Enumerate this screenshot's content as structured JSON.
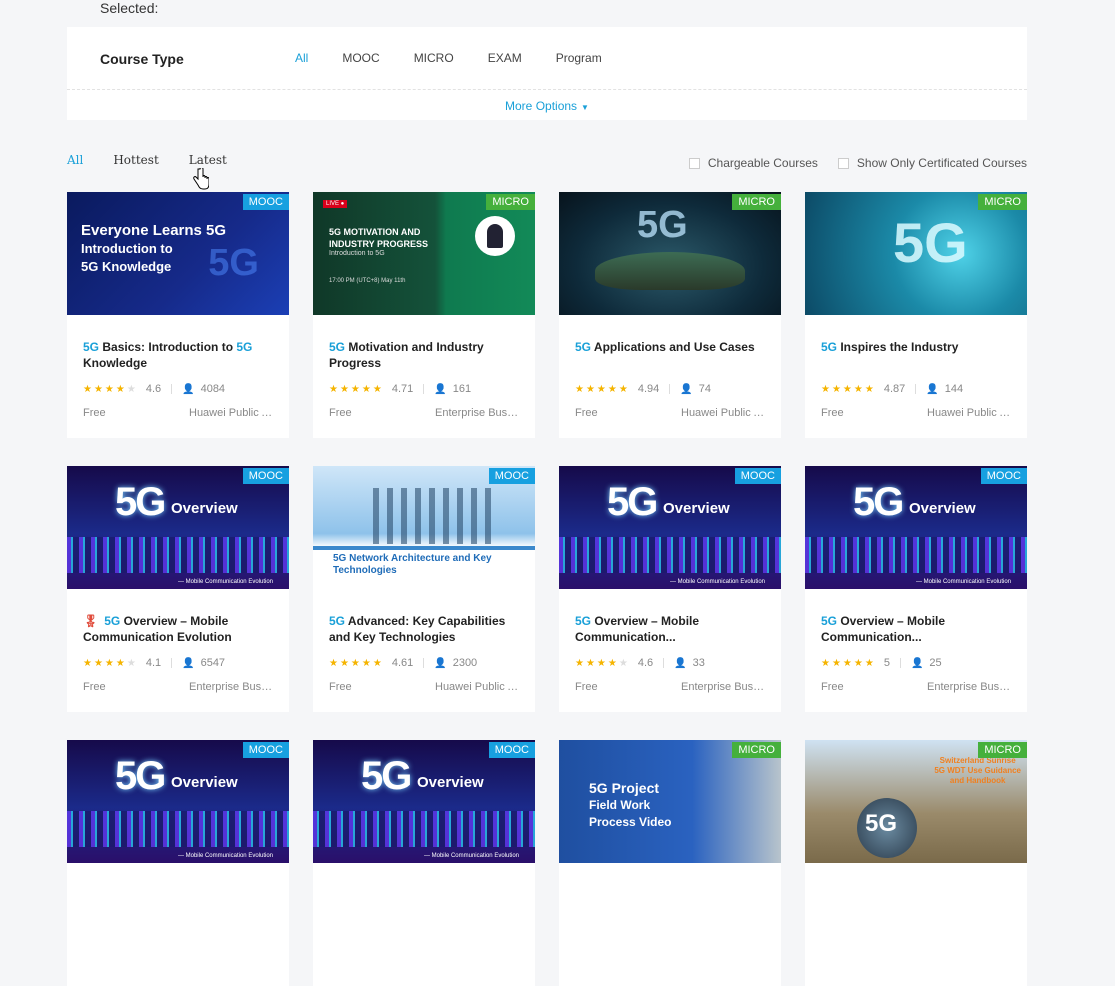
{
  "selected_label": "Selected:",
  "filter": {
    "title": "Course Type",
    "options": [
      "All",
      "MOOC",
      "MICRO",
      "EXAM",
      "Program"
    ],
    "active": "All",
    "more_options": "More Options"
  },
  "sort_tabs": {
    "all": "All",
    "hottest": "Hottest",
    "latest": "Latest"
  },
  "checkboxes": {
    "chargeable": "Chargeable Courses",
    "certificated": "Show Only Certificated Courses"
  },
  "colors": {
    "accent": "#1aa0d8",
    "mooc_badge": "#17a0e0",
    "micro_badge": "#45b03c",
    "star": "#f5b400"
  },
  "courses": [
    {
      "badge": "MOOC",
      "thumb": {
        "line1": "Everyone Learns 5G",
        "line2": "Introduction to",
        "line3": "5G Knowledge",
        "big": "5G"
      },
      "title_parts": [
        "5G",
        " Basics: Introduction to ",
        "5G",
        " Knowledge"
      ],
      "rating": "4.6",
      "learners": "4084",
      "price": "Free",
      "provider": "Huawei Public A..."
    },
    {
      "badge": "MICRO",
      "thumb": {
        "live": "LIVE ●",
        "line1": "5G MOTIVATION AND",
        "line2": "INDUSTRY PROGRESS",
        "line3": "Introduction to 5G",
        "time": "17:00 PM  (UTC+8)   May 11th"
      },
      "title_parts": [
        "5G",
        " Motivation and Industry Progress"
      ],
      "rating": "4.71",
      "learners": "161",
      "price": "Free",
      "provider": "Enterprise Busin..."
    },
    {
      "badge": "MICRO",
      "thumb": {
        "big": "5G"
      },
      "title_parts": [
        "5G",
        " Applications and Use Cases"
      ],
      "rating": "4.94",
      "learners": "74",
      "price": "Free",
      "provider": "Huawei Public A..."
    },
    {
      "badge": "MICRO",
      "thumb": {
        "big": "5G"
      },
      "title_parts": [
        "5G",
        " Inspires the Industry"
      ],
      "rating": "4.87",
      "learners": "144",
      "price": "Free",
      "provider": "Huawei Public A..."
    },
    {
      "badge": "MOOC",
      "thumb": {
        "big": "5G",
        "word": "Overview",
        "caption": "— Mobile Communication Evolution"
      },
      "title_parts": [
        "5G",
        " Overview – Mobile Communication Evolution"
      ],
      "rating": "4.1",
      "learners": "6547",
      "price": "Free",
      "provider": "Enterprise Busin..."
    },
    {
      "badge": "MOOC",
      "thumb": {
        "line1": "5G Network Architecture and Key",
        "line2": "Technologies"
      },
      "title_parts": [
        "5G",
        " Advanced: Key Capabilities and Key Technologies"
      ],
      "rating": "4.61",
      "learners": "2300",
      "price": "Free",
      "provider": "Huawei Public A..."
    },
    {
      "badge": "MOOC",
      "thumb": {
        "big": "5G",
        "word": "Overview",
        "caption": "— Mobile Communication Evolution"
      },
      "title_parts": [
        "5G",
        " Overview – Mobile Communication..."
      ],
      "rating": "4.6",
      "learners": "33",
      "price": "Free",
      "provider": "Enterprise Busin..."
    },
    {
      "badge": "MOOC",
      "thumb": {
        "big": "5G",
        "word": "Overview",
        "caption": "— Mobile Communication Evolution"
      },
      "title_parts": [
        "5G",
        " Overview – Mobile Communication..."
      ],
      "rating": "5",
      "learners": "25",
      "price": "Free",
      "provider": "Enterprise Busin..."
    },
    {
      "badge": "MOOC",
      "thumb": {
        "big": "5G",
        "word": "Overview",
        "caption": "— Mobile Communication Evolution"
      }
    },
    {
      "badge": "MOOC",
      "thumb": {
        "big": "5G",
        "word": "Overview",
        "caption": "— Mobile Communication Evolution"
      }
    },
    {
      "badge": "MICRO",
      "thumb": {
        "line1": "5G Project",
        "line2": "Field Work",
        "line3": "Process Video"
      }
    },
    {
      "badge": "MICRO",
      "thumb": {
        "line1": "Switzerland Sunrise",
        "line2": "5G WDT Use Guidance",
        "line3": "and Handbook",
        "big": "5G"
      }
    }
  ]
}
